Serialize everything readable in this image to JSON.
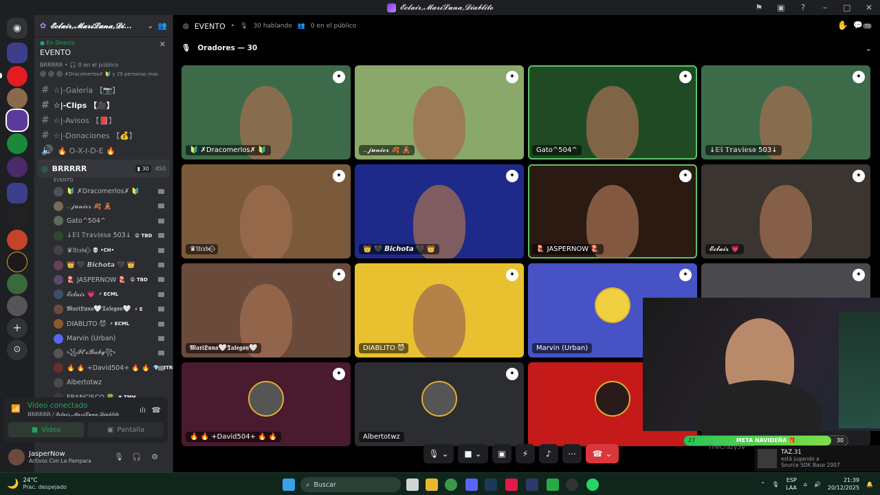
{
  "window": {
    "title": "𝓔𝓬𝓵𝓪𝓲𝓻,𝓜𝓪𝓻𝓲𝓛𝓾𝓷𝓪,𝓓𝓲𝓪𝓫𝓵𝓲𝓽𝓸"
  },
  "sidebar": {
    "server_name": "𝓔𝓬𝓵𝓪𝓲𝓻,𝓜𝓪𝓻𝓲𝓛𝓾𝓷𝓪,𝓓𝓲...",
    "live_label": "En Directo",
    "event_name": "EVENTO",
    "event_meta": "BRRRRR • 🎧 0 en el público",
    "event_people": "✗Dracomerlos✗ 🔰 y 29 personas más",
    "channels": [
      {
        "icon": "#",
        "name": "☆|-Galería 【📷】",
        "bold": false
      },
      {
        "icon": "#",
        "name": "☆|-Clips 【🎥】",
        "bold": true
      },
      {
        "icon": "#",
        "name": "☆|-Avisos 【📕】",
        "bold": false
      },
      {
        "icon": "#",
        "name": "☆|-Donaciones 【💰】",
        "bold": false
      },
      {
        "icon": "🔊",
        "name": "🔥 O-X-I-D-E 🔥",
        "bold": false
      }
    ],
    "voice_channel": {
      "name": "BRRRRR",
      "count": "30",
      "bitrate": "450",
      "sub": "EVENTO"
    },
    "members": [
      {
        "name": "🔰 ✗Dracomerlos✗ 🔰",
        "tag": "",
        "color": "#4e5058"
      },
      {
        "name": "..𝓳𝓾𝓷𝓲𝓸𝓻 🍂 🧸",
        "tag": "",
        "color": "#7a6a5a"
      },
      {
        "name": "Gato^504^",
        "tag": "",
        "color": "#5c6b5a"
      },
      {
        "name": "↓𝔼𝕝 𝕋𝕣𝕒𝕧𝕚𝕖𝕤𝕠 503↓",
        "tag": "😝 TBD",
        "color": "#2e4a2e"
      },
      {
        "name": "♛𝔘𝔯𝔵𝔟𝔢-⃟",
        "tag": "💀 •CH•",
        "color": "#444"
      },
      {
        "name": "👑 🖤 𝘽𝙞𝙘𝙝𝙤𝙩𝙖 🖤 👑",
        "tag": "",
        "color": "#6b3e5c"
      },
      {
        "name": "🪼 JASPERNOW 🪼",
        "tag": "😝 TBD",
        "color": "#5a4a6b"
      },
      {
        "name": "𝓔𝓬𝓵𝓪𝓲𝓻 💗",
        "tag": "⚡ ECML",
        "color": "#3b4f6b"
      },
      {
        "name": "𝕸𝖆𝖗𝖎𝕷𝖚𝖓𝖆🤍𝕿𝖆𝖑𝖊𝖌𝖔𝖓🤍",
        "tag": "⚡ E",
        "color": "#6b4a3e"
      },
      {
        "name": "DIABLITO 😈",
        "tag": "⚡ ECML",
        "color": "#8a5a2a"
      },
      {
        "name": "Marvin (Urban)",
        "tag": "",
        "color": "#5865f2"
      },
      {
        "name": "꧁𝓘𝓽'𝓼𝓑𝓪𝓫𝔂꧂",
        "tag": "",
        "color": "#555"
      },
      {
        "name": "🔥 🔥 +David504+ 🔥 🔥",
        "tag": "💎 MTRP",
        "color": "#6b2e2e"
      },
      {
        "name": "Albertotwz",
        "tag": "",
        "color": "#4a4a4a"
      },
      {
        "name": "FRANCISCO 🍀",
        "tag": "✖ TMH",
        "color": "#3a3a3a"
      }
    ],
    "voice_status": {
      "title": "Video conectado",
      "sub": "BRRRRR / 𝓔𝓬𝓵𝓪𝓲𝓻,𝓜𝓪𝓻𝓲𝓛𝓾𝓷𝓪,𝓓𝓲𝓪𝓫𝓵𝓲𝓽𝓸",
      "video": "Video",
      "screen": "Pantalla"
    },
    "user": {
      "name": "JasperNow",
      "status": "Activos Con La Pampara"
    }
  },
  "main": {
    "event_title": "EVENTO",
    "talking": "30 hablando",
    "audience": "0 en el público",
    "speakers_label": "Oradores — 30",
    "notif_count": "70",
    "tiles": [
      {
        "name": "🔰 ✗Dracomerlos✗ 🔰",
        "bg": "#3d6b4a"
      },
      {
        "name": "..𝓳𝓾𝓷𝓲𝓸𝓻 🍂 🧸",
        "bg": "#8aa86a"
      },
      {
        "name": "Gato^504^",
        "bg": "#1f4a24"
      },
      {
        "name": "↓𝔼𝕝 𝕋𝕣𝕒𝕧𝕚𝕖𝕤𝕠 503↓",
        "bg": "#3d6b4a"
      },
      {
        "name": "♛𝔘𝔯𝔵𝔟𝔢-⃟",
        "bg": "#7a5a3a"
      },
      {
        "name": "👑 🖤 𝘽𝙞𝙘𝙝𝙤𝙩𝙖 🖤 👑",
        "bg": "#1e2a8a"
      },
      {
        "name": "🪼 JASPERNOW 🪼",
        "bg": "#2a1a12"
      },
      {
        "name": "𝓔𝓬𝓵𝓪𝓲𝓻 💗",
        "bg": "#3a3530"
      },
      {
        "name": "𝕸𝖆𝖗𝖎𝕷𝖚𝖓𝖆🤍𝕿𝖆𝖑𝖊𝖌𝖔𝖓🤍",
        "bg": "#6a4a3a"
      },
      {
        "name": "DIABLITO 😈",
        "bg": "#e8c030"
      },
      {
        "name": "Marvin (Urban)",
        "bg": "#4752c4"
      },
      {
        "name": "",
        "bg": "#4a4a4e"
      },
      {
        "name": "🔥 🔥 +David504+ 🔥 🔥",
        "bg": "#4a1a2e"
      },
      {
        "name": "Albertotwz",
        "bg": "#2b2d31"
      },
      {
        "name": "",
        "bg": "#c41a1a"
      },
      {
        "name": "",
        "bg": "#1e1f22"
      }
    ]
  },
  "overlay": {
    "goal_label": "META NAVIDEÑA 🎁",
    "goal_current": "27",
    "goal_target": "30",
    "goal_progress": 0.9,
    "under_name": "TheCrazy3V",
    "game_user": "TAZ.31",
    "game_status": "está jugando a",
    "game_name": "Source SDK Base 2007"
  },
  "taskbar": {
    "temp": "24°C",
    "weather": "Prac. despejado",
    "search": "Buscar",
    "lang1": "ESP",
    "lang2": "LAA",
    "time": "21:39",
    "date": "20/12/2025"
  }
}
